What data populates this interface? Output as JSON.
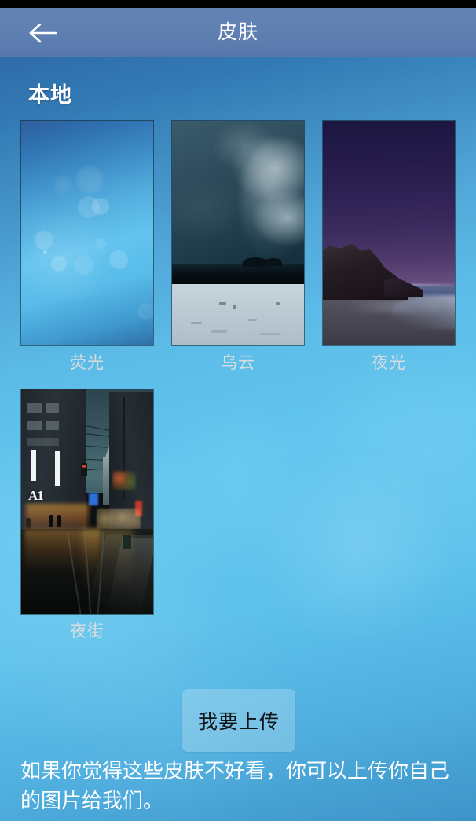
{
  "header": {
    "title": "皮肤",
    "back_icon": "arrow-left-icon"
  },
  "section": {
    "title": "本地"
  },
  "skins": [
    {
      "label": "荧光",
      "art": "bokeh"
    },
    {
      "label": "乌云",
      "art": "storm"
    },
    {
      "label": "夜光",
      "art": "coast"
    },
    {
      "label": "夜街",
      "art": "street"
    }
  ],
  "upload": {
    "label": "我要上传"
  },
  "footer": {
    "note": "如果你觉得这些皮肤不好看，你可以上传你自己的图片给我们。"
  },
  "colors": {
    "header_bg": "#5e7fb1",
    "page_top": "#2e6ca9",
    "page_mid": "#62c6ef",
    "page_bottom": "#3d93c8",
    "title_text": "#ffffff",
    "label_text": "#d9dde0",
    "button_text": "#111416"
  }
}
